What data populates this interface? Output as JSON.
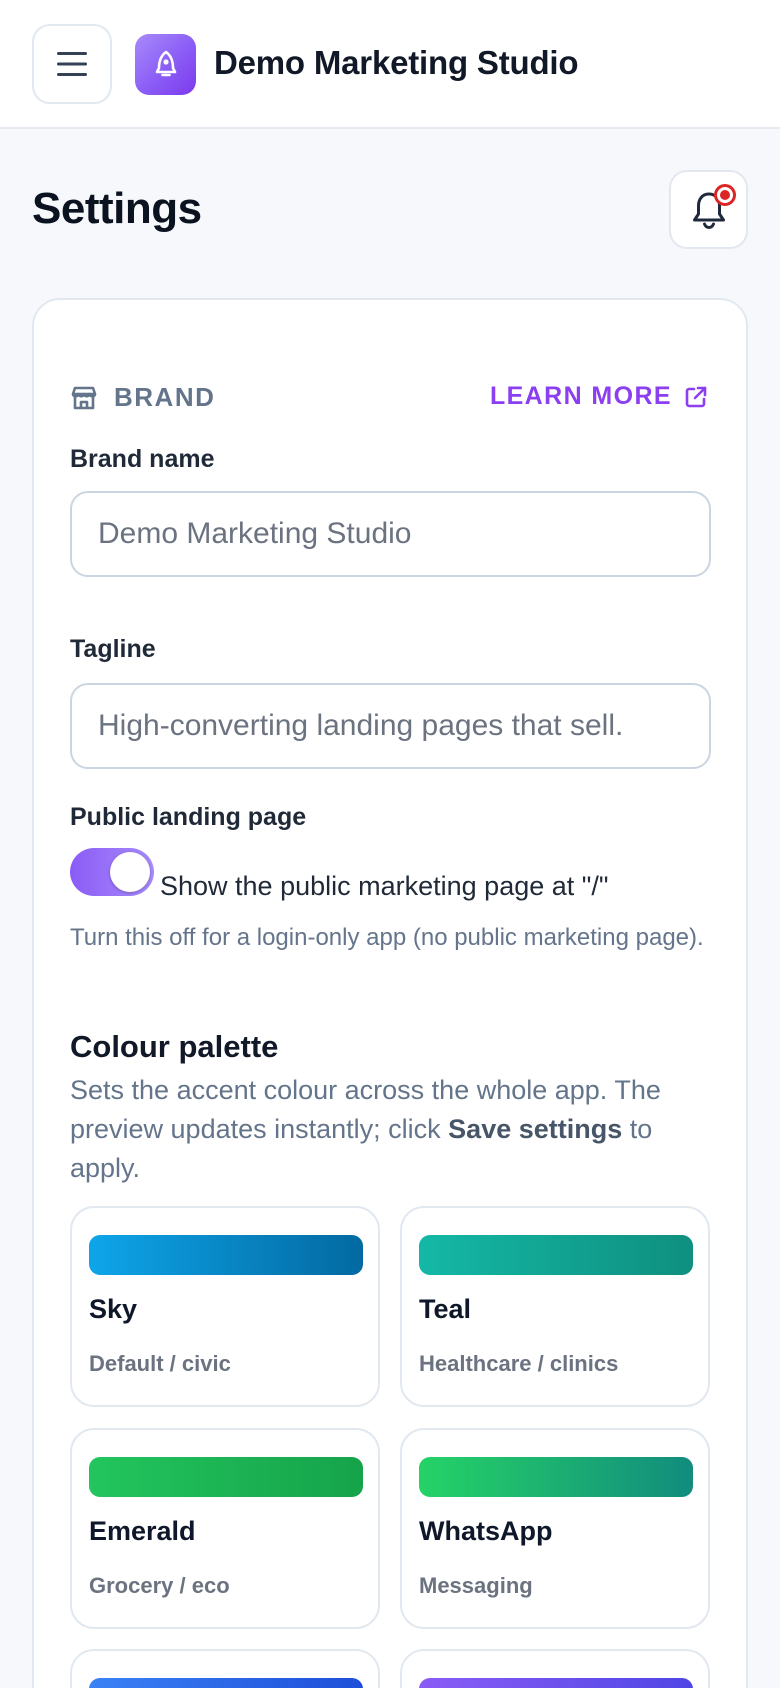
{
  "header": {
    "app_title": "Demo Marketing Studio",
    "menu_icon": "hamburger-menu-icon",
    "logo_icon": "rocket-bell-icon"
  },
  "page": {
    "title": "Settings",
    "notification_icon": "bell-icon",
    "notification_status": "unread"
  },
  "brand_section": {
    "label": "BRAND",
    "icon": "storefront-icon",
    "learn_more": "LEARN MORE",
    "learn_more_icon": "external-link-icon",
    "brand_name_label": "Brand name",
    "brand_name_placeholder": "Demo Marketing Studio",
    "brand_name_value": "",
    "tagline_label": "Tagline",
    "tagline_placeholder": "High-converting landing pages that sell.",
    "tagline_value": "",
    "public_page_label": "Public landing page",
    "public_page_enabled": true,
    "public_page_toggle_text": "Show the public marketing page at \"/\"",
    "public_page_helper": "Turn this off for a login-only app (no public marketing page)."
  },
  "palette_section": {
    "title": "Colour palette",
    "desc_before": "Sets the accent colour across the whole app. The preview updates instantly; click ",
    "desc_bold": "Save settings",
    "desc_after": " to apply.",
    "options": [
      {
        "name": "Sky",
        "subtitle": "Default / civic",
        "from": "#0ea5e9",
        "to": "#0369a1"
      },
      {
        "name": "Teal",
        "subtitle": "Healthcare / clinics",
        "from": "#14b8a6",
        "to": "#0f8f7f"
      },
      {
        "name": "Emerald",
        "subtitle": "Grocery / eco",
        "from": "#22c55e",
        "to": "#16a34a"
      },
      {
        "name": "WhatsApp",
        "subtitle": "Messaging",
        "from": "#25d366",
        "to": "#128c7e"
      },
      {
        "name": "",
        "subtitle": "",
        "from": "#3b82f6",
        "to": "#1d4ed8"
      },
      {
        "name": "",
        "subtitle": "",
        "from": "#8b5cf6",
        "to": "#4f46e5"
      }
    ]
  },
  "colors": {
    "accent": "#8b3ff0",
    "page_bg": "#f6f8fb",
    "border": "#e2e8f0",
    "alert": "#dc2626"
  }
}
